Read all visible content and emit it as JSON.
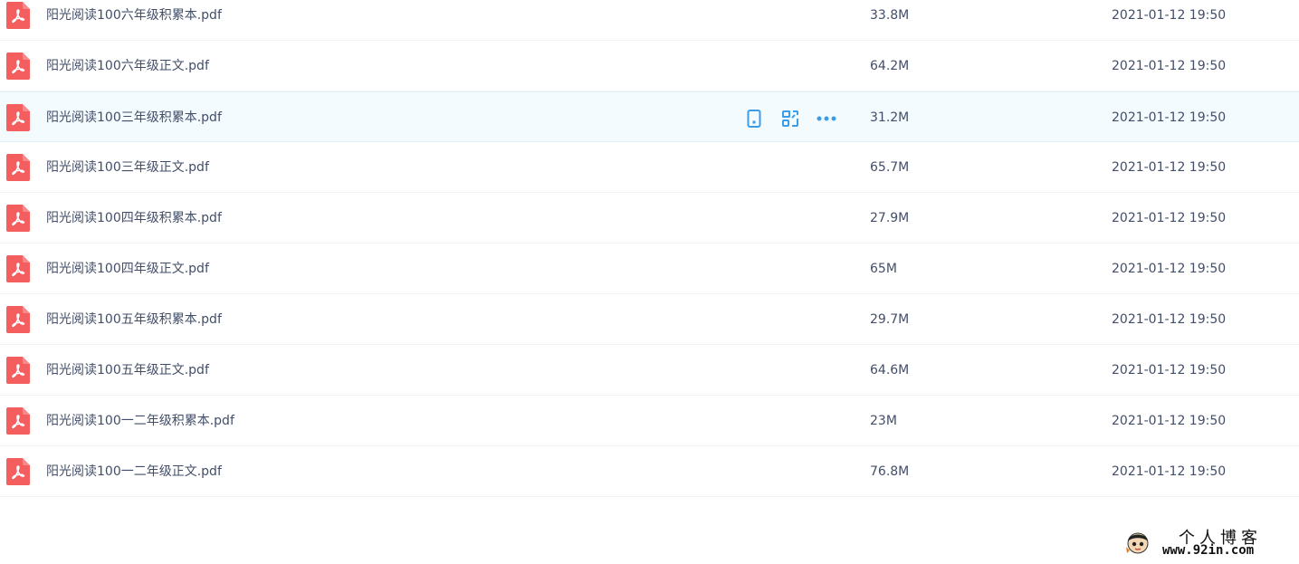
{
  "colors": {
    "text": "#424e67",
    "pdf_icon": "#f45e5e",
    "action_icon": "#3b9de8",
    "hover_row": "#f4fbff"
  },
  "files": [
    {
      "name": "阳光阅读100六年级积累本.pdf",
      "size": "33.8M",
      "date": "2021-01-12 19:50",
      "icon": "pdf-icon"
    },
    {
      "name": "阳光阅读100六年级正文.pdf",
      "size": "64.2M",
      "date": "2021-01-12 19:50",
      "icon": "pdf-icon"
    },
    {
      "name": "阳光阅读100三年级积累本.pdf",
      "size": "31.2M",
      "date": "2021-01-12 19:50",
      "icon": "pdf-icon",
      "hovered": true
    },
    {
      "name": "阳光阅读100三年级正文.pdf",
      "size": "65.7M",
      "date": "2021-01-12 19:50",
      "icon": "pdf-icon"
    },
    {
      "name": "阳光阅读100四年级积累本.pdf",
      "size": "27.9M",
      "date": "2021-01-12 19:50",
      "icon": "pdf-icon"
    },
    {
      "name": "阳光阅读100四年级正文.pdf",
      "size": "65M",
      "date": "2021-01-12 19:50",
      "icon": "pdf-icon"
    },
    {
      "name": "阳光阅读100五年级积累本.pdf",
      "size": "29.7M",
      "date": "2021-01-12 19:50",
      "icon": "pdf-icon"
    },
    {
      "name": "阳光阅读100五年级正文.pdf",
      "size": "64.6M",
      "date": "2021-01-12 19:50",
      "icon": "pdf-icon"
    },
    {
      "name": "阳光阅读100一二年级积累本.pdf",
      "size": "23M",
      "date": "2021-01-12 19:50",
      "icon": "pdf-icon"
    },
    {
      "name": "阳光阅读100一二年级正文.pdf",
      "size": "76.8M",
      "date": "2021-01-12 19:50",
      "icon": "pdf-icon"
    }
  ],
  "row_actions": [
    "phone-icon",
    "share-icon",
    "more-icon"
  ],
  "watermark": {
    "title": "个人博客",
    "url": "www.92in.com"
  }
}
